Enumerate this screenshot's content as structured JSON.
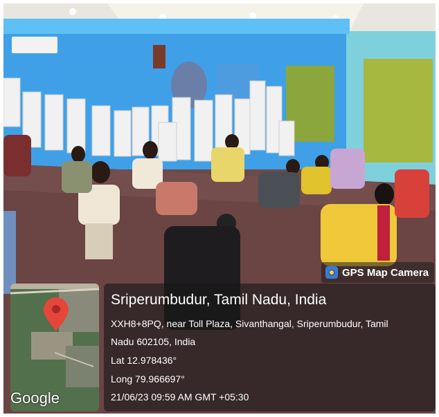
{
  "badge": {
    "label": "GPS Map Camera",
    "icon": "gps-camera-icon"
  },
  "map": {
    "provider": "Google",
    "pin_color": "#e5463a"
  },
  "location": {
    "title": "Sriperumbudur, Tamil Nadu, India",
    "address_line1": "XXH8+8PQ, near Toll Plaza, Sivanthangal, Sriperumbudur, Tamil",
    "address_line2": "Nadu 602105, India",
    "lat": "Lat 12.978436°",
    "long": "Long 79.966697°",
    "datetime": "21/06/23 09:59 AM GMT +05:30"
  },
  "colors": {
    "wall": "#3fa0e8",
    "floor": "#6b4444",
    "overlay": "#1e1e1e"
  }
}
